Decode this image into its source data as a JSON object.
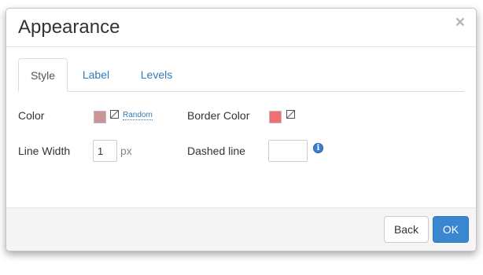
{
  "dialog": {
    "title": "Appearance",
    "close_glyph": "×",
    "close_icon": "close-icon"
  },
  "tabs": [
    {
      "label": "Style",
      "active": true
    },
    {
      "label": "Label",
      "active": false
    },
    {
      "label": "Levels",
      "active": false
    }
  ],
  "style": {
    "color_label": "Color",
    "color_value": "#c99696",
    "color_none_icon": "no-color-icon",
    "random_label": "Random",
    "border_color_label": "Border Color",
    "border_color_value": "#f06f73",
    "border_none_icon": "no-color-icon",
    "line_width_label": "Line Width",
    "line_width_value": "1",
    "line_width_unit": "px",
    "dashed_line_label": "Dashed line",
    "dashed_line_value": "",
    "info_icon": "info-icon",
    "info_glyph": "i"
  },
  "footer": {
    "back_label": "Back",
    "ok_label": "OK",
    "ok_color": "#3a87cf"
  }
}
